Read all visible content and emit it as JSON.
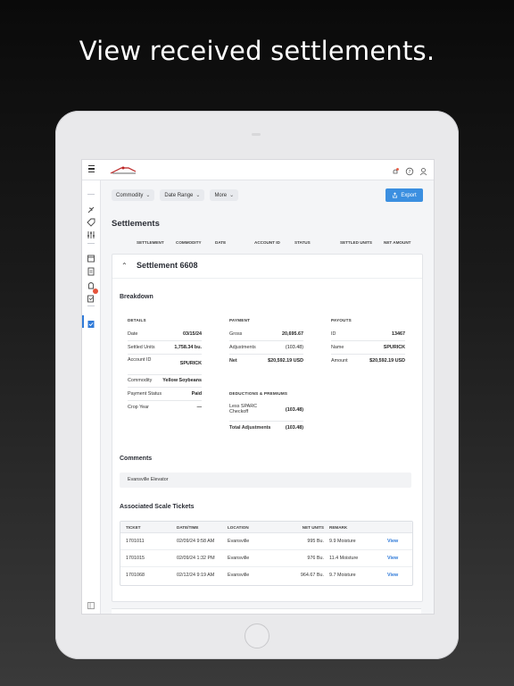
{
  "headline": "View received settlements.",
  "filters": [
    {
      "label": "Commodity"
    },
    {
      "label": "Date Range"
    },
    {
      "label": "More"
    }
  ],
  "export_label": "Export",
  "page_title": "Settlements",
  "columns": [
    "SETTLEMENT",
    "COMMODITY",
    "DATE",
    "ACCOUNT ID",
    "STATUS",
    "SETTLED UNITS",
    "NET AMOUNT"
  ],
  "settlement": {
    "title": "Settlement 6608",
    "breakdown_title": "Breakdown",
    "details": {
      "heading": "DETAILS",
      "rows": [
        {
          "k": "Date",
          "v": "03/15/24"
        },
        {
          "k": "Settled Units",
          "v": "1,758.34 bu."
        },
        {
          "k": "Account ID",
          "v": "SPURICK"
        },
        {
          "k": "Commodity",
          "v": "Yellow Soybeans"
        },
        {
          "k": "Payment Status",
          "v": "Paid"
        },
        {
          "k": "Crop Year",
          "v": "—"
        }
      ]
    },
    "payment": {
      "heading": "PAYMENT",
      "rows": [
        {
          "k": "Gross",
          "v": "20,695.67"
        },
        {
          "k": "Adjustments",
          "v": "(103.48)"
        },
        {
          "k": "Net",
          "v": "$20,592.19 USD"
        }
      ]
    },
    "deductions": {
      "heading": "DEDUCTIONS & PREMIUMS",
      "rows": [
        {
          "k": "Less SPARC Checkoff",
          "v": "(103.48)"
        },
        {
          "k": "Total Adjustments",
          "v": "(103.48)"
        }
      ]
    },
    "payouts": {
      "heading": "PAYOUTS",
      "rows": [
        {
          "k": "ID",
          "v": "13467"
        },
        {
          "k": "Name",
          "v": "SPURICK"
        },
        {
          "k": "Amount",
          "v": "$20,592.19 USD"
        }
      ]
    },
    "comments_title": "Comments",
    "comment": "Evansville Elevator",
    "tickets_title": "Associated Scale Tickets",
    "ticket_headers": [
      "TICKET",
      "DATE/TIME",
      "LOCATION",
      "NET UNITS",
      "REMARK"
    ],
    "tickets": [
      {
        "ticket": "1701011",
        "datetime": "02/09/24 9:58 AM",
        "location": "Evansville",
        "net_units": "995 Bu.",
        "remark": "9.9 Moisture",
        "action": "View"
      },
      {
        "ticket": "1701015",
        "datetime": "02/09/24 1:32 PM",
        "location": "Evansville",
        "net_units": "976 Bu.",
        "remark": "11.4 Moisture",
        "action": "View"
      },
      {
        "ticket": "1701068",
        "datetime": "02/12/24 9:19 AM",
        "location": "Evansville",
        "net_units": "964.67 Bu.",
        "remark": "9.7 Moisture",
        "action": "View"
      }
    ]
  },
  "colors": {
    "accent": "#3b8fe0",
    "link": "#2f7ad8",
    "alert": "#e5533b"
  }
}
